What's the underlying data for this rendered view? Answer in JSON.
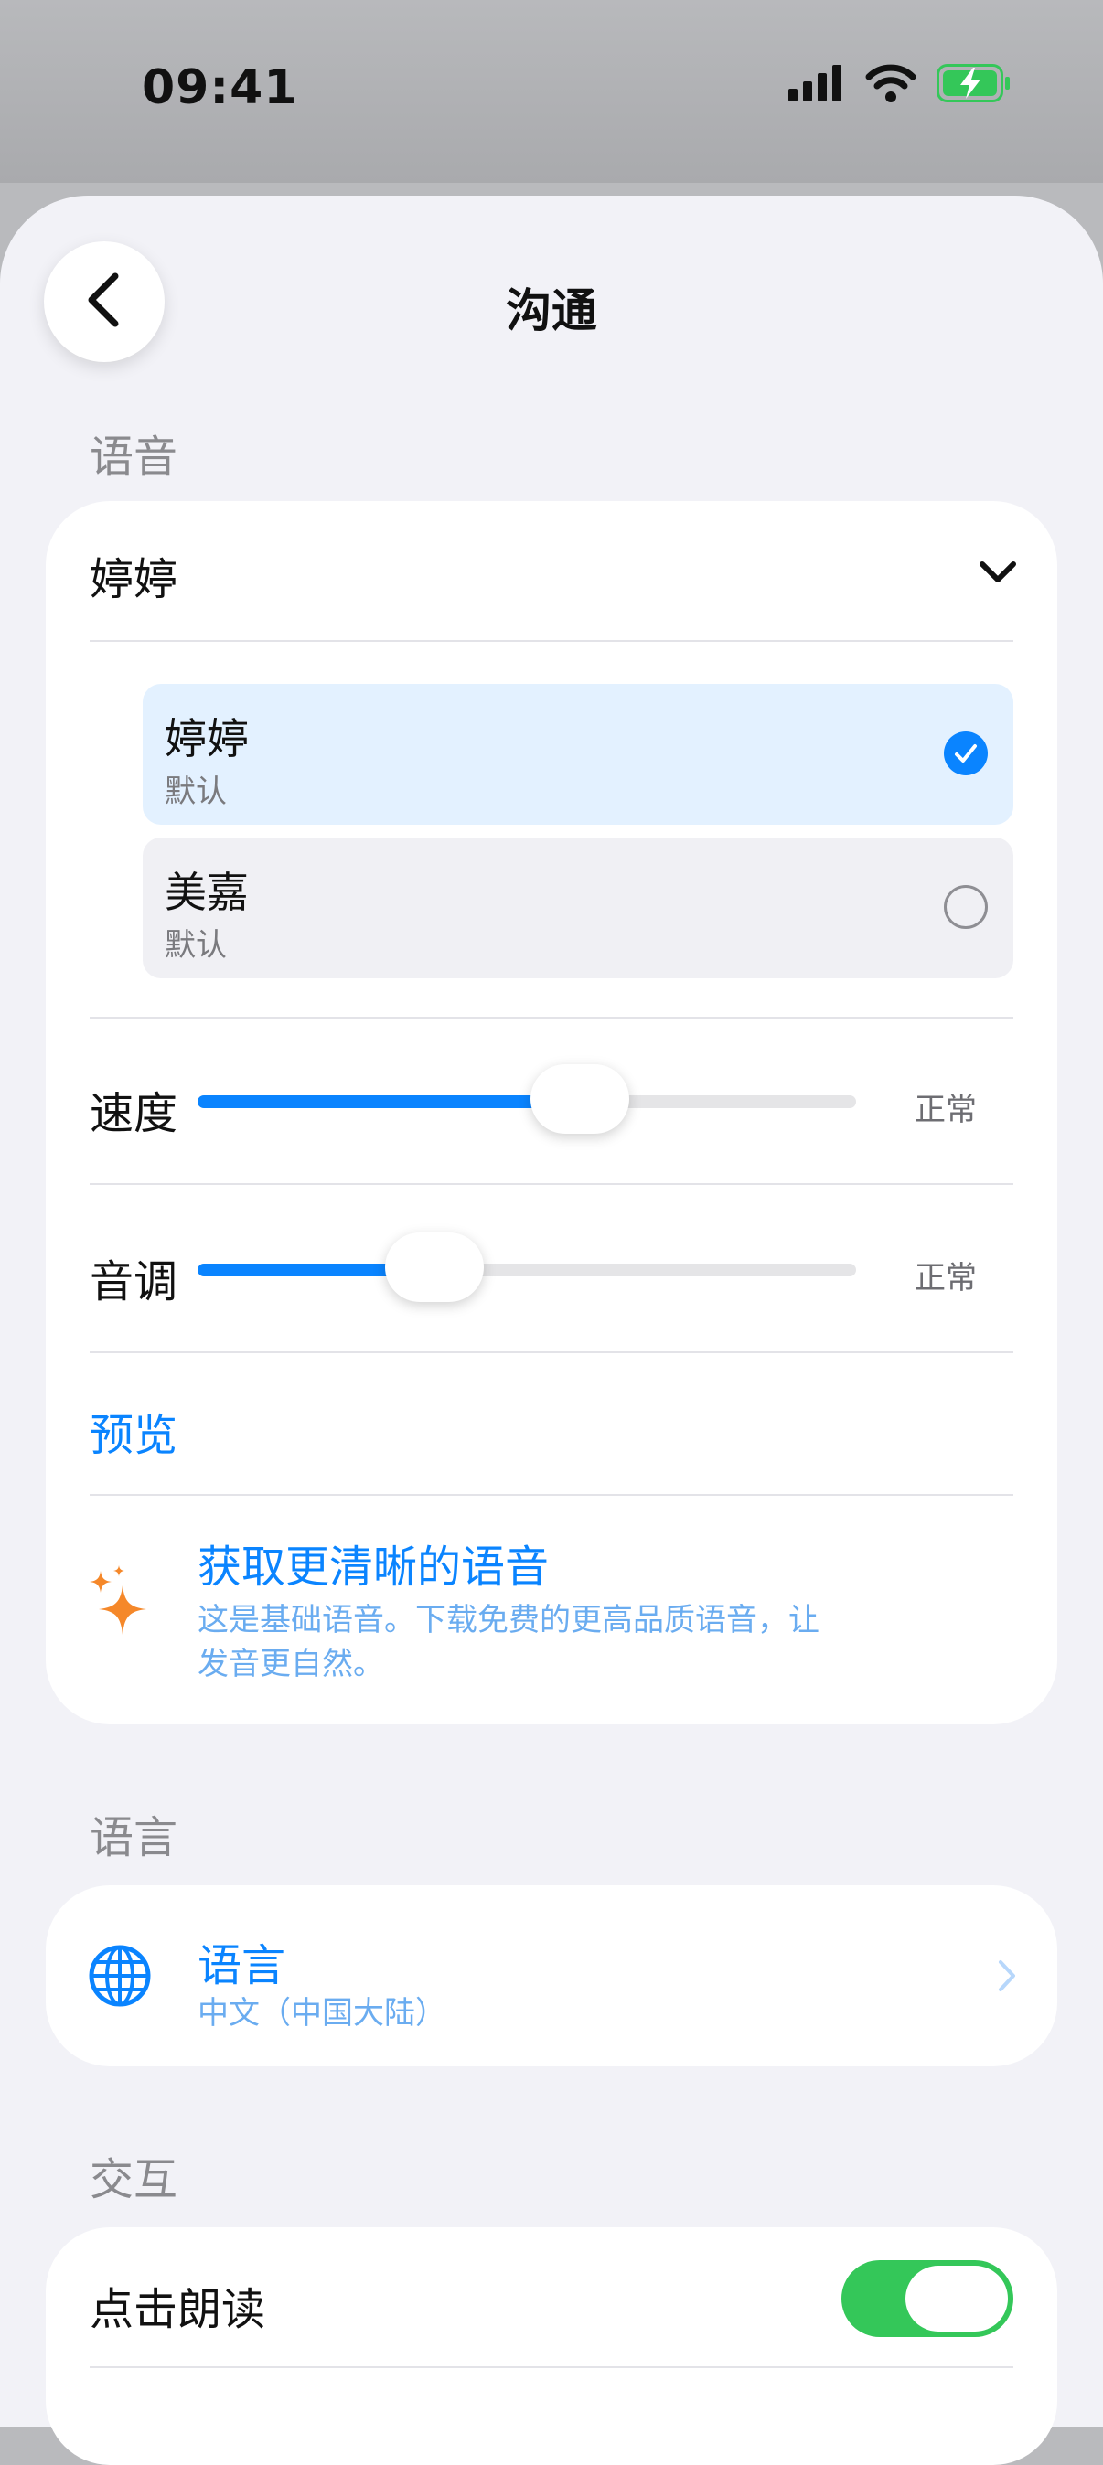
{
  "status_bar": {
    "time": "09:41",
    "battery_color": "#34c759"
  },
  "nav": {
    "title": "沟通",
    "back_icon": "chevron-left-icon"
  },
  "voice_section": {
    "label": "语音",
    "selected_voice": "婷婷",
    "options": [
      {
        "name": "婷婷",
        "sub": "默认",
        "selected": true
      },
      {
        "name": "美嘉",
        "sub": "默认",
        "selected": false
      }
    ],
    "speed": {
      "label": "速度",
      "value_text": "正常",
      "level": 0.58
    },
    "pitch": {
      "label": "音调",
      "value_text": "正常",
      "level": 0.36
    },
    "preview_label": "预览",
    "upgrade": {
      "icon": "sparkles-icon",
      "title": "获取更清晰的语音",
      "desc_line1": "这是基础语音。下载免费的更高品质语音，让",
      "desc_line2": "发音更自然。"
    }
  },
  "language_section": {
    "label": "语言",
    "item_title": "语言",
    "item_value": "中文（中国大陆）",
    "icon": "globe-icon"
  },
  "interaction_section": {
    "label": "交互",
    "tap_to_speak": {
      "label": "点击朗读",
      "enabled": true
    }
  },
  "colors": {
    "accent": "#0a84ff",
    "selected_bg": "#e3f1ff",
    "unselected_bg": "#f0f0f4",
    "sparkle": "#f5882a",
    "toggle_on": "#34c759"
  }
}
